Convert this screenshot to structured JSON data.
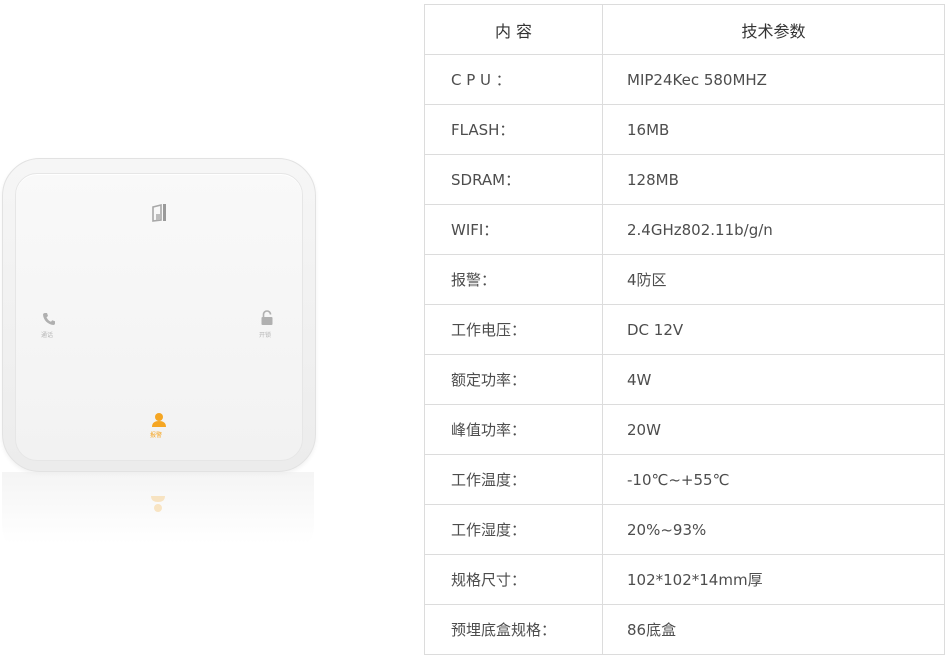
{
  "device": {
    "captions": {
      "call": "通话",
      "unlock": "开锁",
      "alarm": "报警"
    },
    "accent_color": "#f5a623"
  },
  "table": {
    "headers": {
      "content": "内  容",
      "params": "技术参数"
    },
    "rows": [
      {
        "key": "C P U ：",
        "value": "MIP24Kec 580MHZ"
      },
      {
        "key": "FLASH：",
        "value": "16MB"
      },
      {
        "key": "SDRAM：",
        "value": "128MB"
      },
      {
        "key": "WIFI：",
        "value": "2.4GHz802.11b/g/n"
      },
      {
        "key": "报警：",
        "value": "4防区"
      },
      {
        "key": "工作电压：",
        "value": "DC 12V"
      },
      {
        "key": "额定功率：",
        "value": "4W"
      },
      {
        "key": "峰值功率：",
        "value": "20W"
      },
      {
        "key": "工作温度：",
        "value": "-10℃~+55℃"
      },
      {
        "key": "工作湿度：",
        "value": "20%~93%"
      },
      {
        "key": "规格尺寸：",
        "value": "102*102*14mm厚"
      },
      {
        "key": "预埋底盒规格：",
        "value": "86底盒"
      }
    ]
  }
}
